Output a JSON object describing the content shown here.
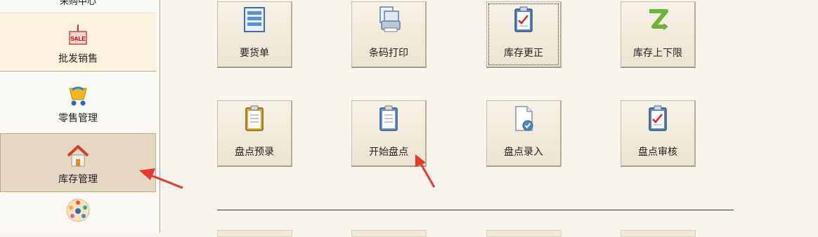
{
  "sidebar": {
    "items": [
      {
        "label": "采购中心",
        "icon": "purchase-icon"
      },
      {
        "label": "批发销售",
        "icon": "sale-tag-icon"
      },
      {
        "label": "零售管理",
        "icon": "stroller-cart-icon"
      },
      {
        "label": "库存管理",
        "icon": "house-icon"
      },
      {
        "label": "",
        "icon": "people-circle-icon"
      }
    ],
    "selected": "库存管理"
  },
  "modules": [
    {
      "label": "要货单",
      "icon": "list-document-icon"
    },
    {
      "label": "条码打印",
      "icon": "barcode-printer-icon"
    },
    {
      "label": "库存更正",
      "icon": "clipboard-check-icon",
      "focused": true
    },
    {
      "label": "库存上下限",
      "icon": "z-limit-icon"
    },
    {
      "label": "盘点预录",
      "icon": "clipboard-icon"
    },
    {
      "label": "开始盘点",
      "icon": "clipboard-blue-icon"
    },
    {
      "label": "盘点录入",
      "icon": "document-check-icon"
    },
    {
      "label": "盘点审核",
      "icon": "clipboard-check-icon"
    }
  ],
  "colors": {
    "background": "#f8f5ef",
    "tile": "#ece4d2",
    "selected_sidebar": "#e4d9c0",
    "annotation_arrow": "#e8382e"
  }
}
